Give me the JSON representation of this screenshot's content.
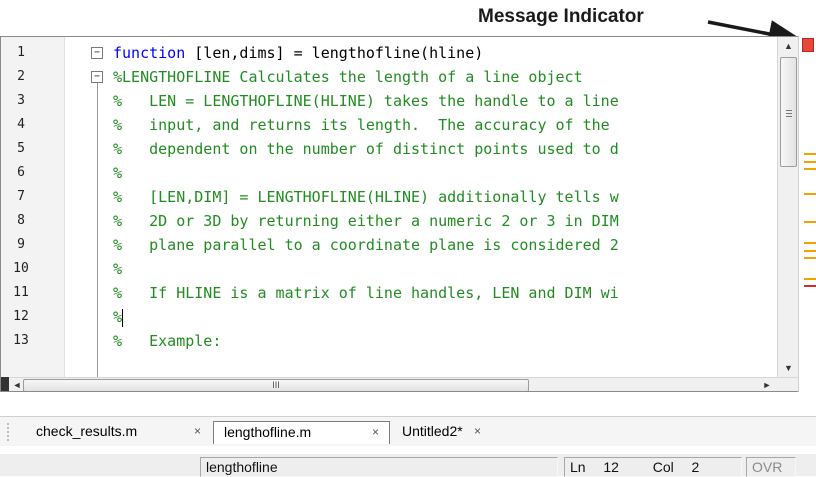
{
  "callout": {
    "label": "Message Indicator"
  },
  "editor": {
    "line_numbers": [
      "1",
      "2",
      "3",
      "4",
      "5",
      "6",
      "7",
      "8",
      "9",
      "10",
      "11",
      "12",
      "13"
    ],
    "lines": [
      {
        "segments": [
          {
            "cls": "kw",
            "text": "function"
          },
          {
            "cls": "plain",
            "text": " [len,dims] = lengthofline(hline)"
          }
        ]
      },
      {
        "segments": [
          {
            "cls": "cm",
            "text": "%LENGTHOFLINE Calculates the length of a line object"
          }
        ]
      },
      {
        "segments": [
          {
            "cls": "cm",
            "text": "%   LEN = LENGTHOFLINE(HLINE) takes the handle to a line"
          }
        ]
      },
      {
        "segments": [
          {
            "cls": "cm",
            "text": "%   input, and returns its length.  The accuracy of the"
          }
        ]
      },
      {
        "segments": [
          {
            "cls": "cm",
            "text": "%   dependent on the number of distinct points used to d"
          }
        ]
      },
      {
        "segments": [
          {
            "cls": "cm",
            "text": "%"
          }
        ]
      },
      {
        "segments": [
          {
            "cls": "cm",
            "text": "%   [LEN,DIM] = LENGTHOFLINE(HLINE) additionally tells w"
          }
        ]
      },
      {
        "segments": [
          {
            "cls": "cm",
            "text": "%   2D or 3D by returning either a numeric 2 or 3 in DIM"
          }
        ]
      },
      {
        "segments": [
          {
            "cls": "cm",
            "text": "%   plane parallel to a coordinate plane is considered 2"
          }
        ]
      },
      {
        "segments": [
          {
            "cls": "cm",
            "text": "%"
          }
        ]
      },
      {
        "segments": [
          {
            "cls": "cm",
            "text": "%   If HLINE is a matrix of line handles, LEN and DIM wi"
          }
        ]
      },
      {
        "segments": [
          {
            "cls": "cm",
            "text": "%"
          }
        ]
      },
      {
        "segments": [
          {
            "cls": "cm",
            "text": "%   Example:"
          }
        ]
      }
    ],
    "cursor_line": 12
  },
  "colors": {
    "keyword": "#0000ff",
    "comment": "#228b22",
    "indicator": "#e8473e",
    "warning_mark": "#f5a100",
    "error_mark": "#d62b2b"
  },
  "message_marks": [
    {
      "line_fraction": 0.33,
      "type": "warning"
    },
    {
      "line_fraction": 0.35,
      "type": "warning"
    },
    {
      "line_fraction": 0.37,
      "type": "warning"
    },
    {
      "line_fraction": 0.44,
      "type": "warning"
    },
    {
      "line_fraction": 0.52,
      "type": "warning"
    },
    {
      "line_fraction": 0.58,
      "type": "warning"
    },
    {
      "line_fraction": 0.6,
      "type": "warning"
    },
    {
      "line_fraction": 0.62,
      "type": "warning"
    },
    {
      "line_fraction": 0.68,
      "type": "warning"
    },
    {
      "line_fraction": 0.7,
      "type": "error"
    }
  ],
  "tabs": [
    {
      "label": "check_results.m",
      "close": "×",
      "active": false
    },
    {
      "label": "lengthofline.m",
      "close": "×",
      "active": true
    },
    {
      "label": "Untitled2*",
      "close": "×",
      "active": false
    }
  ],
  "statusbar": {
    "function_name": "lengthofline",
    "ln_label": "Ln",
    "ln_value": "12",
    "col_label": "Col",
    "col_value": "2",
    "mode": "OVR"
  },
  "scroll": {
    "up_icon": "▲",
    "down_icon": "▼",
    "left_icon": "◄",
    "right_icon": "►",
    "thumb_grip": "III"
  }
}
